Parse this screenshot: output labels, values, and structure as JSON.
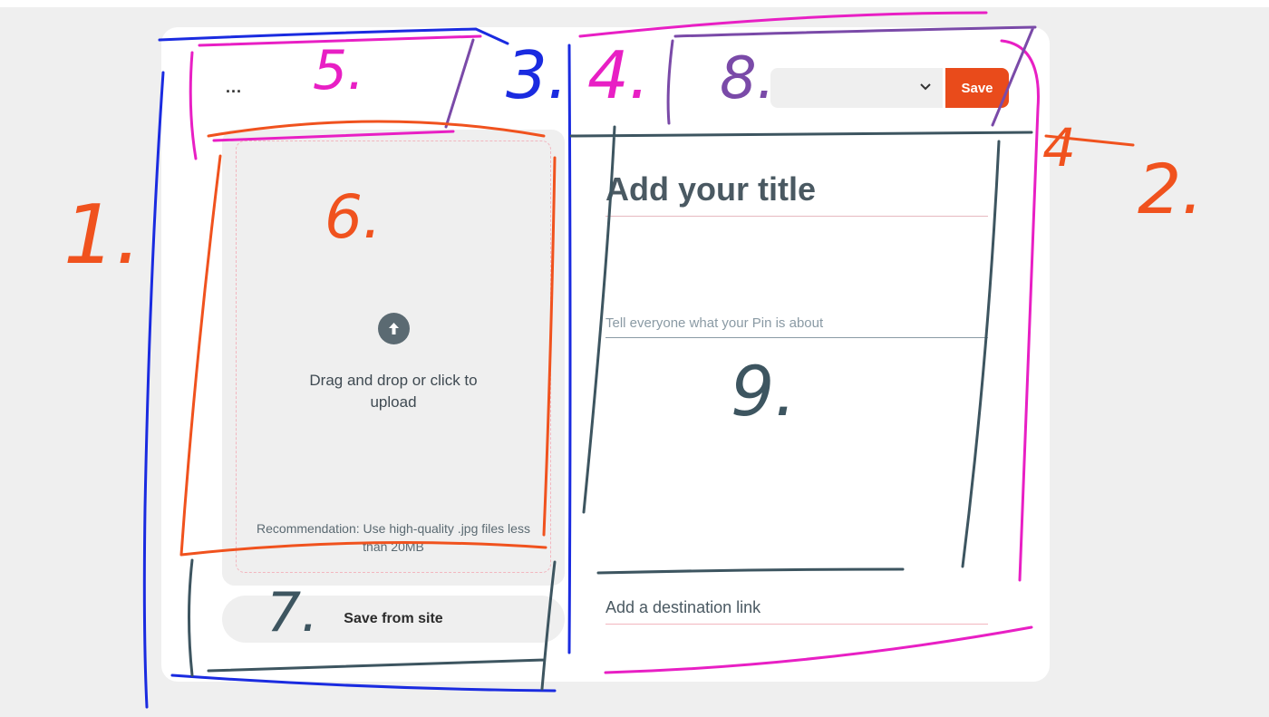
{
  "header": {
    "more_label": "...",
    "board_select_value": "",
    "save_label": "Save"
  },
  "upload": {
    "prompt": "Drag and drop or click to upload",
    "recommendation": "Recommendation: Use high-quality .jpg files less than 20MB",
    "save_from_site_label": "Save from site"
  },
  "form": {
    "title_placeholder": "Add your title",
    "description_placeholder": "Tell everyone what your Pin is about",
    "link_placeholder": "Add a destination link"
  },
  "annotations": {
    "labels": [
      "1.",
      "2.",
      "3.",
      "4.",
      "4",
      "5.",
      "6.",
      "7.",
      "8.",
      "9."
    ],
    "colors": {
      "blue": "#1a2be0",
      "magenta": "#e81fc4",
      "orange": "#f0521e",
      "slate": "#3d5560",
      "purple": "#7a4aa8"
    }
  },
  "colors": {
    "accent": "#e94b1b",
    "background": "#efefef",
    "card": "#ffffff"
  }
}
